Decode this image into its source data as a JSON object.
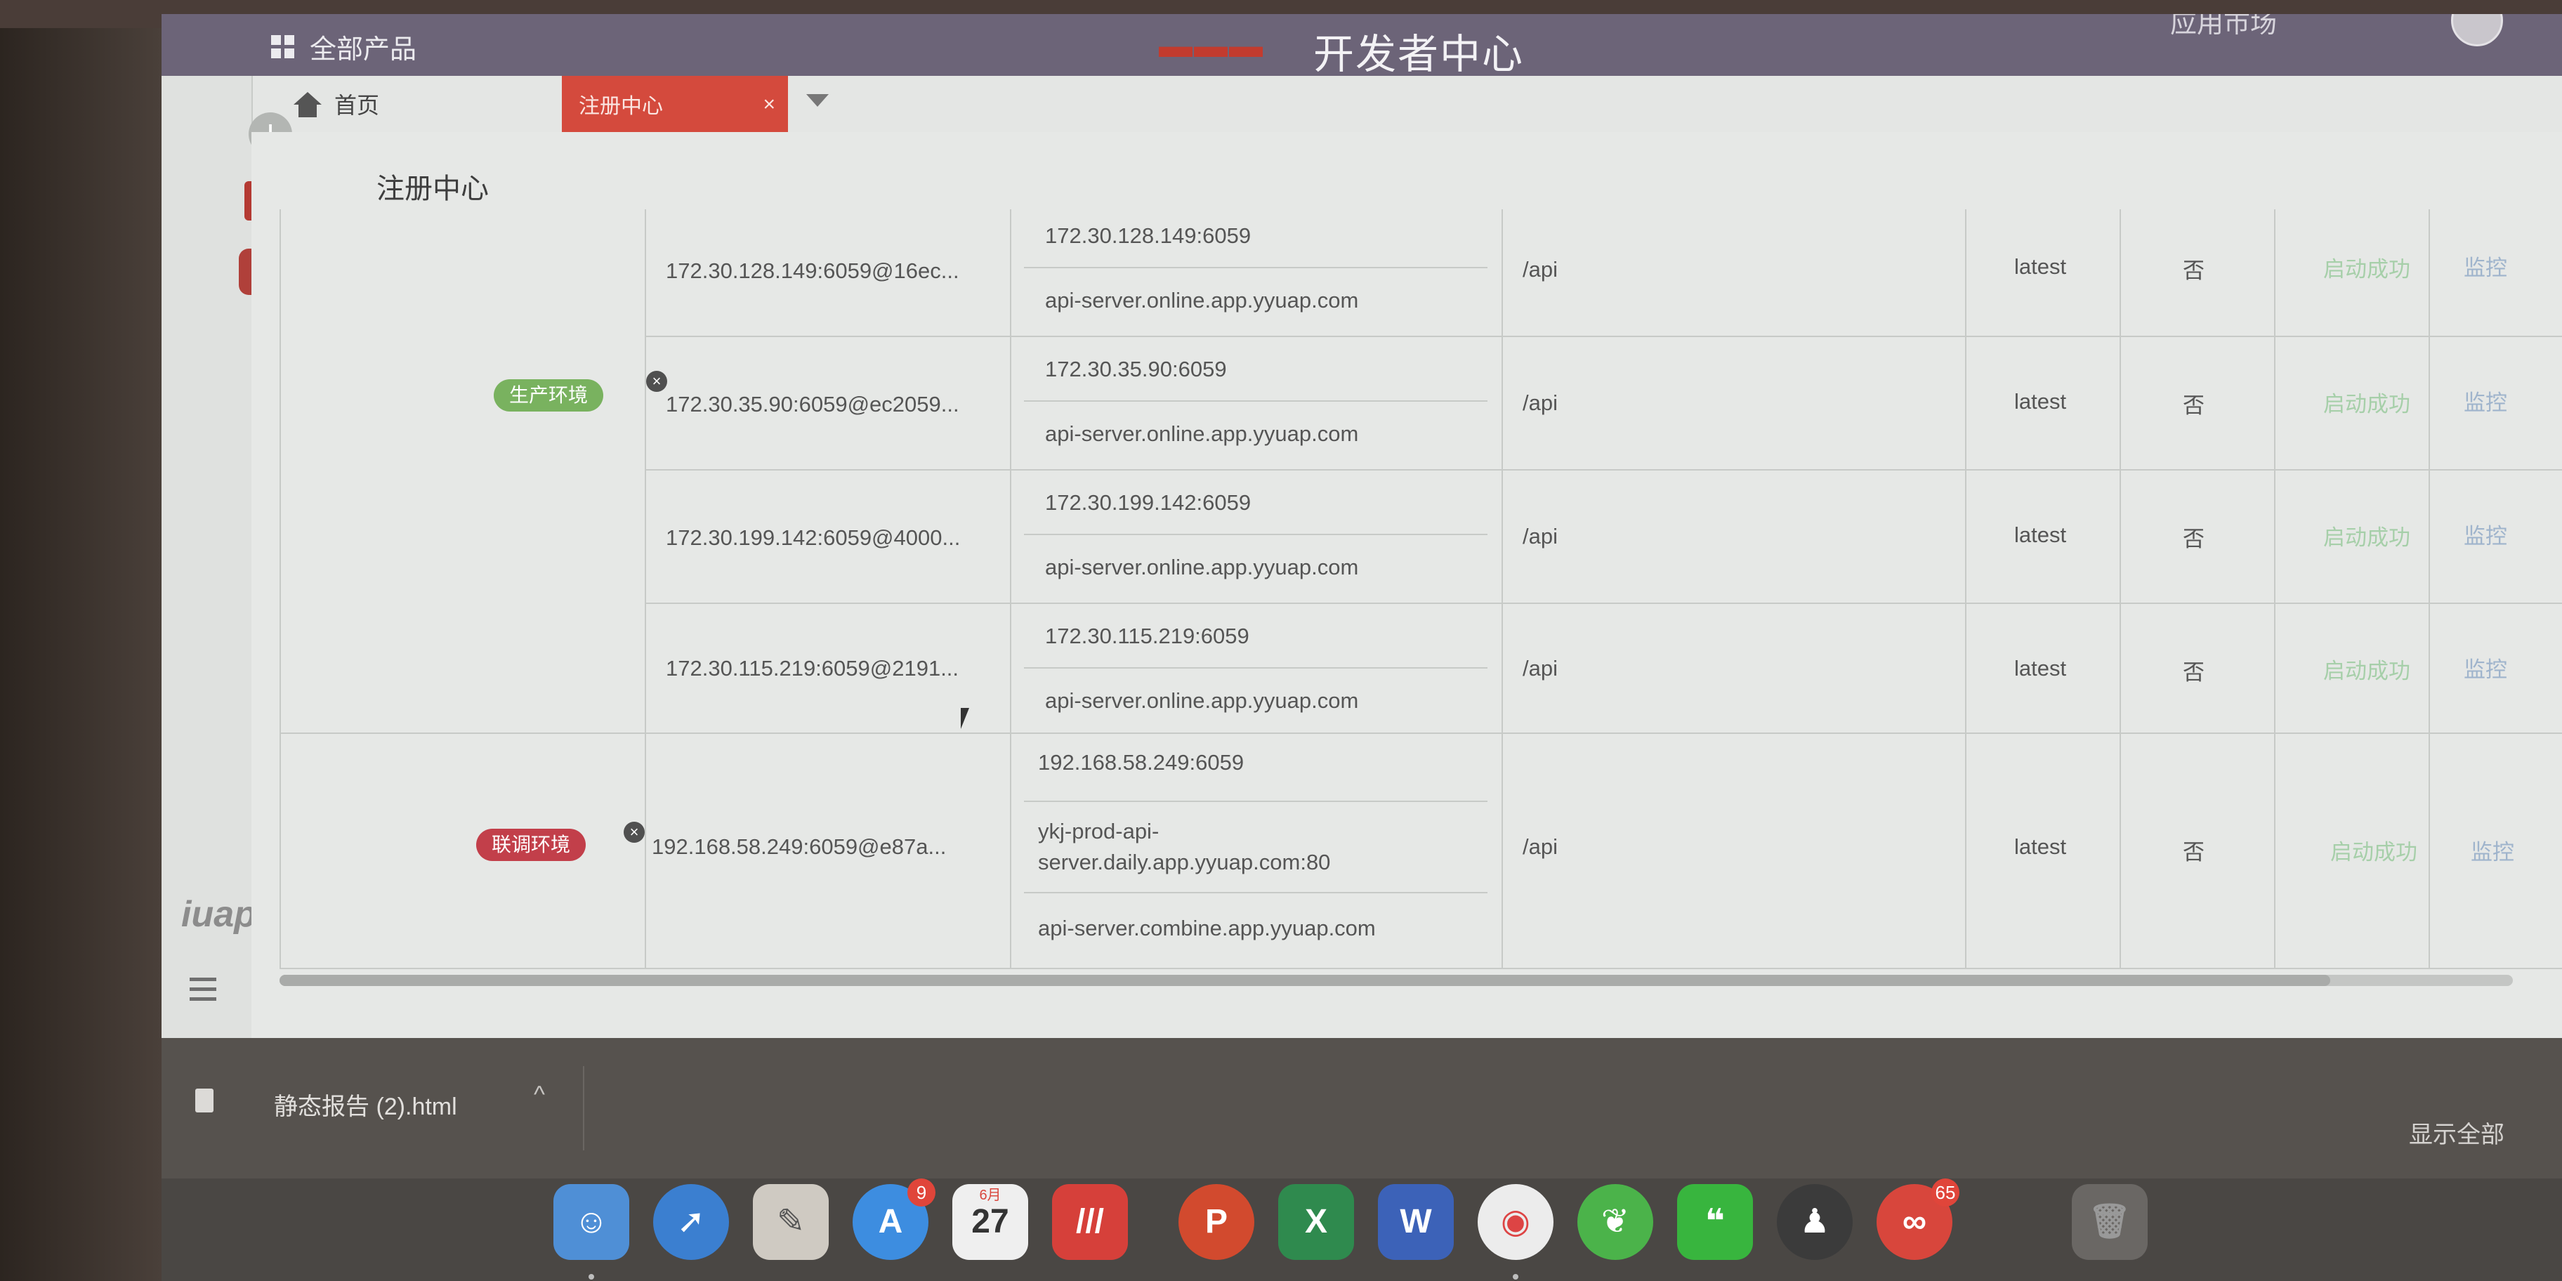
{
  "header": {
    "all_products": "全部产品",
    "portal_title": "开发者中心",
    "app_market": "应用市场"
  },
  "tabs": {
    "home": "首页",
    "active": "注册中心"
  },
  "page": {
    "title": "注册中心"
  },
  "table": {
    "rows": [
      {
        "instance": "172.30.128.149:6059@16ec...",
        "addresses": [
          "172.30.128.149:6059",
          "api-server.online.app.yyuap.com"
        ],
        "path": "/api",
        "version": "latest",
        "flag": "否",
        "status": "启动成功",
        "action": "监控"
      },
      {
        "instance": "172.30.35.90:6059@ec2059...",
        "addresses": [
          "172.30.35.90:6059",
          "api-server.online.app.yyuap.com"
        ],
        "path": "/api",
        "version": "latest",
        "flag": "否",
        "status": "启动成功",
        "action": "监控"
      },
      {
        "instance": "172.30.199.142:6059@4000...",
        "addresses": [
          "172.30.199.142:6059",
          "api-server.online.app.yyuap.com"
        ],
        "path": "/api",
        "version": "latest",
        "flag": "否",
        "status": "启动成功",
        "action": "监控"
      },
      {
        "instance": "172.30.115.219:6059@2191...",
        "addresses": [
          "172.30.115.219:6059",
          "api-server.online.app.yyuap.com"
        ],
        "path": "/api",
        "version": "latest",
        "flag": "否",
        "status": "启动成功",
        "action": "监控"
      },
      {
        "instance": "192.168.58.249:6059@e87a...",
        "addresses": [
          "192.168.58.249:6059",
          "ykj-prod-api-server.daily.app.yyuap.com:80",
          "api-server.combine.app.yyuap.com"
        ],
        "path": "/api",
        "version": "latest",
        "flag": "否",
        "status": "启动成功",
        "action": "监控"
      }
    ],
    "env_prod": "生产环境",
    "env_joint": "联调环境"
  },
  "downloads": {
    "file_name": "静态报告 (2).html",
    "show_all": "显示全部"
  },
  "rail": {
    "logo": "iuap"
  },
  "dock": {
    "appstore_badge": "9",
    "calendar_month": "6月",
    "calendar_day": "27",
    "last_badge": "65"
  },
  "colors": {
    "header": "#6c6478",
    "active_tab": "#d44a3d",
    "env_prod": "#79b25f",
    "env_joint": "#c23f4a",
    "status_success": "#a6cfa9",
    "monitor_link": "#9fb4cc"
  }
}
